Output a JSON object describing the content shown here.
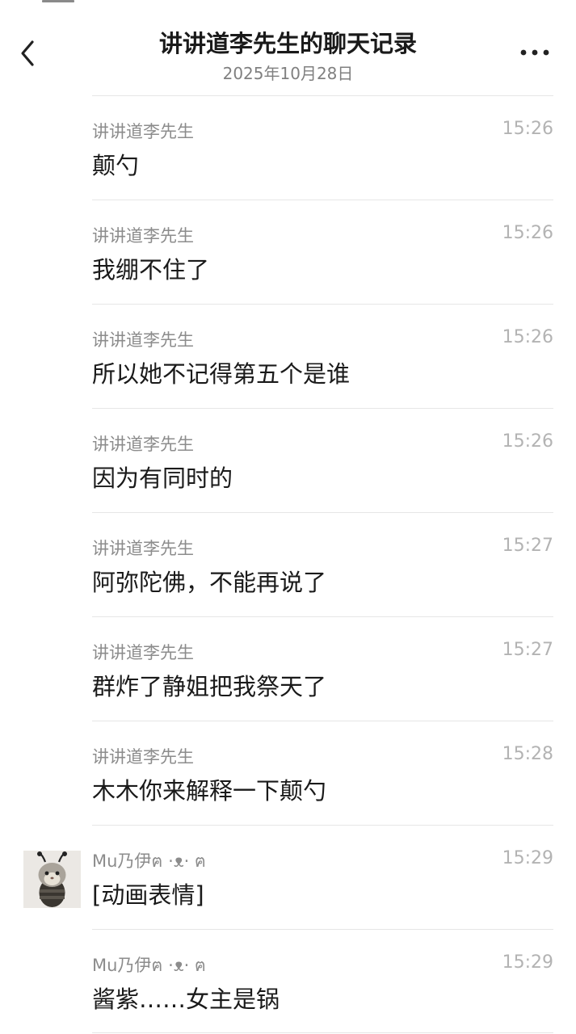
{
  "header": {
    "title": "讲讲道李先生的聊天记录",
    "date": "2025年10月28日"
  },
  "icons": {
    "back": "chevron-left-icon",
    "more": "more-dots-icon",
    "avatar": "bee-costume-cat-avatar"
  },
  "messages": [
    {
      "sender": "讲讲道李先生",
      "time": "15:26",
      "text": "颠勺"
    },
    {
      "sender": "讲讲道李先生",
      "time": "15:26",
      "text": "我绷不住了"
    },
    {
      "sender": "讲讲道李先生",
      "time": "15:26",
      "text": "所以她不记得第五个是谁"
    },
    {
      "sender": "讲讲道李先生",
      "time": "15:26",
      "text": "因为有同时的"
    },
    {
      "sender": "讲讲道李先生",
      "time": "15:27",
      "text": "阿弥陀佛，不能再说了"
    },
    {
      "sender": "讲讲道李先生",
      "time": "15:27",
      "text": "群炸了静姐把我祭天了"
    },
    {
      "sender": "讲讲道李先生",
      "time": "15:28",
      "text": "木木你来解释一下颠勺"
    },
    {
      "sender": "Mu乃伊ฅ ·ᴥ· ฅ",
      "time": "15:29",
      "text": "[动画表情]"
    },
    {
      "sender": "Mu乃伊ฅ ·ᴥ· ฅ",
      "time": "15:29",
      "text": "酱紫……女主是锅"
    }
  ]
}
